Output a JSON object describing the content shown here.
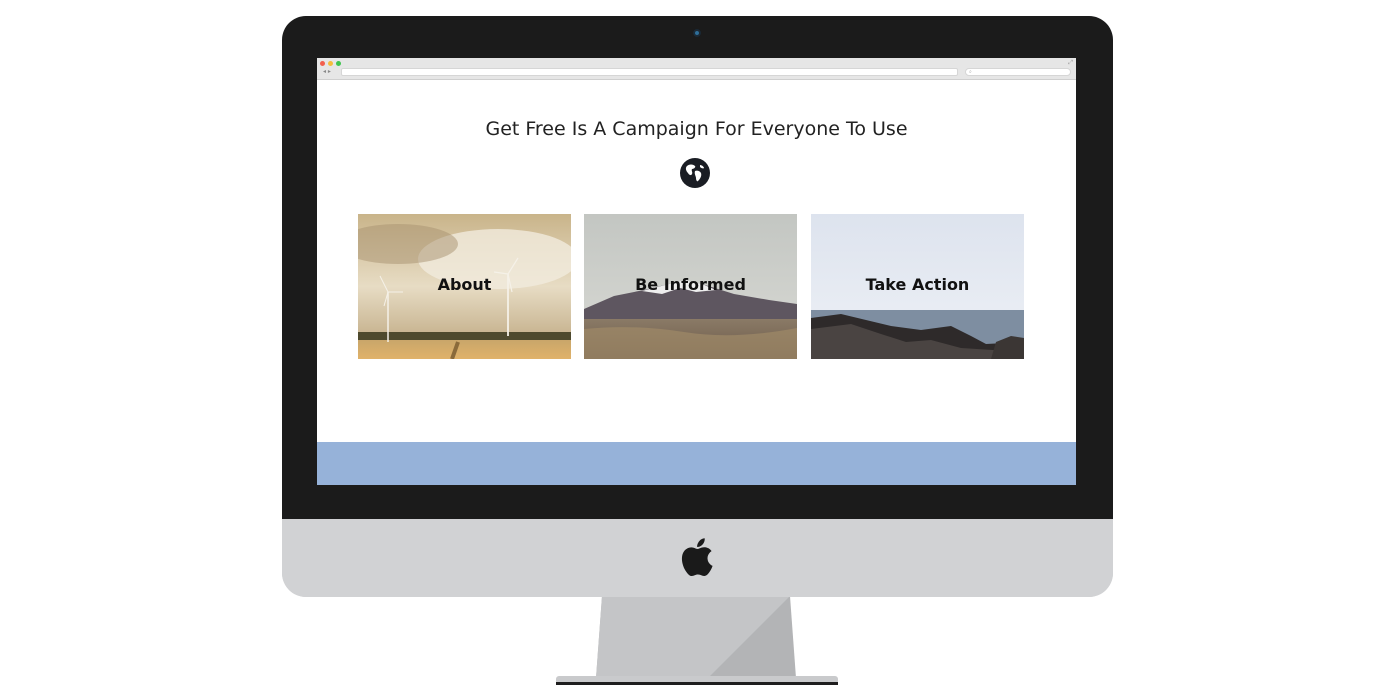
{
  "colors": {
    "bezel": "#1b1b1b",
    "chin": "#d1d2d4",
    "stand": "#b8b9bb",
    "footer_band": "#96b2d9",
    "headline_text": "#222222"
  },
  "browser": {
    "url": "",
    "search_placeholder": ""
  },
  "page": {
    "headline": "Get Free Is A Campaign For Everyone To Use",
    "cards": [
      {
        "label": "About",
        "image": "wind-turbines-field"
      },
      {
        "label": "Be Informed",
        "image": "snowy-mountain-plain"
      },
      {
        "label": "Take Action",
        "image": "rocky-shore-sea"
      }
    ]
  },
  "icons": {
    "globe": "globe-icon",
    "apple": "apple-logo-icon"
  }
}
